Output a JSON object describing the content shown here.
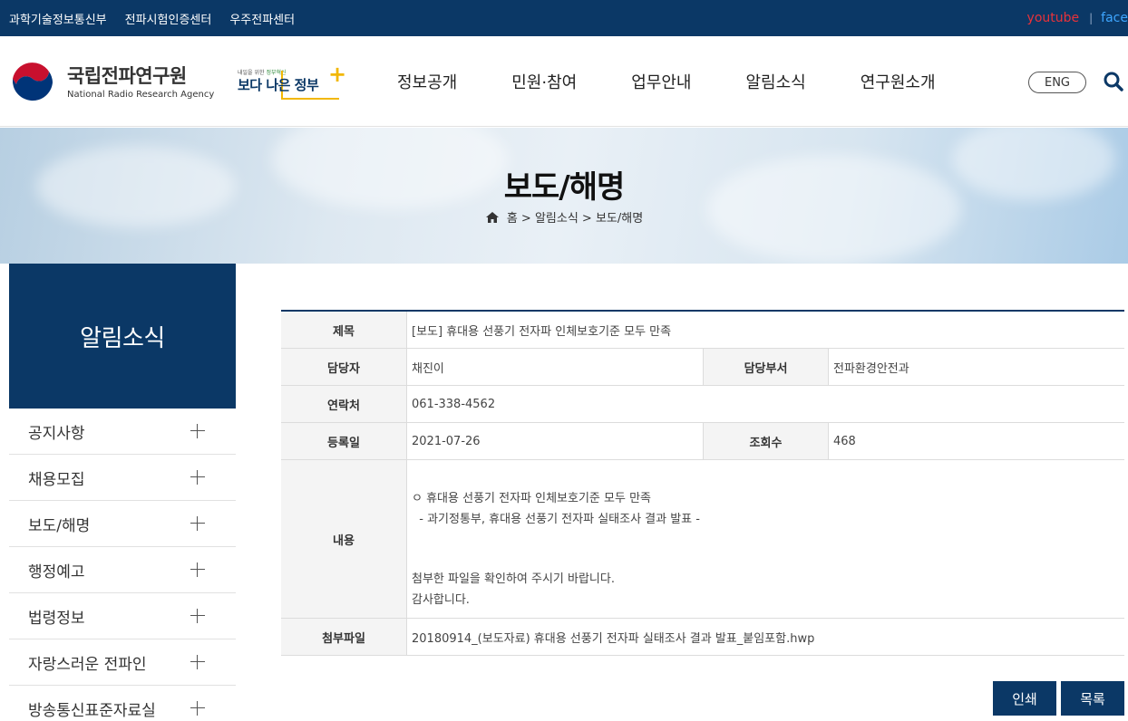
{
  "utility": {
    "links": [
      "과학기술정보통신부",
      "전파시험인증센터",
      "우주전파센터"
    ],
    "sns": {
      "youtube": "youtube",
      "separator": "|",
      "facebook": "face"
    }
  },
  "site": {
    "logo_ko": "국립전파연구원",
    "logo_en": "National Radio Research Agency",
    "gov_small": "내일을 위한",
    "gov_small_accent": "정부혁신",
    "gov_big": "보다 나은 정부",
    "gov_plus": "+"
  },
  "gnb": [
    "정보공개",
    "민원·참여",
    "업무안내",
    "알림소식",
    "연구원소개"
  ],
  "header": {
    "eng_label": "ENG"
  },
  "visual": {
    "title": "보도/해명",
    "breadcrumb": "홈 > 알림소식 > 보도/해명"
  },
  "sidebar": {
    "title": "알림소식",
    "items": [
      {
        "label": "공지사항"
      },
      {
        "label": "채용모집"
      },
      {
        "label": "보도/해명"
      },
      {
        "label": "행정예고"
      },
      {
        "label": "법령정보"
      },
      {
        "label": "자랑스러운 전파인"
      },
      {
        "label": "방송통신표준자료실"
      }
    ]
  },
  "post": {
    "subject_label": "제목",
    "subject": "[보도] 휴대용 선풍기 전자파 인체보호기준 모두 만족",
    "author_label": "담당자",
    "author": "채진이",
    "dept_label": "담당부서",
    "dept": "전파환경안전과",
    "contact_label": "연락처",
    "contact": "061-338-4562",
    "date_label": "등록일",
    "date": "2021-07-26",
    "views_label": "조회수",
    "views": "468",
    "content_label": "내용",
    "content_line1": "ㅇ 휴대용 선풍기 전자파 인체보호기준 모두 만족",
    "content_line2": "  - 과기정통부, 휴대용 선풍기 전자파 실태조사 결과 발표 -",
    "content_line3": "첨부한 파일을 확인하여 주시기 바랍니다.",
    "content_line4": "감사합니다.",
    "attach_label": "첨부파일",
    "attach": "20180914_(보도자료) 휴대용 선풍기 전자파 실태조사 결과 발표_붙임포함.hwp"
  },
  "buttons": {
    "print": "인쇄",
    "list": "목록"
  },
  "colors": {
    "navy": "#0b3866",
    "youtube": "#e8323a",
    "facebook": "#3ea6ff",
    "gov_yellow": "#f2b705"
  },
  "icons": {
    "search": "search-icon",
    "home": "home-icon",
    "emblem": "korea-emblem-icon"
  }
}
